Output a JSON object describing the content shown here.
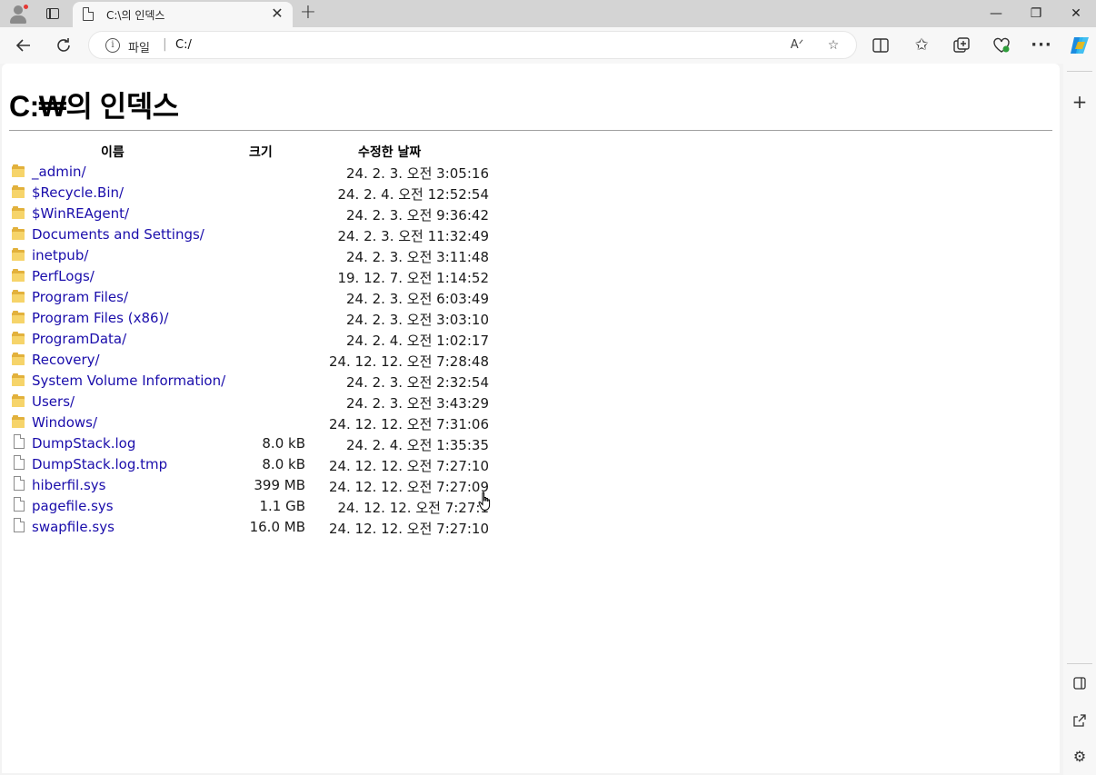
{
  "tab": {
    "title": "C:\\의 인덱스"
  },
  "window_controls": {
    "minimize": "—",
    "restore": "❐",
    "close": "✕"
  },
  "address_bar": {
    "scheme": "파일",
    "url": "C:/"
  },
  "page": {
    "title": "C:₩의 인덱스",
    "columns": {
      "name": "이름",
      "size": "크기",
      "date": "수정한 날짜"
    },
    "entries": [
      {
        "type": "folder",
        "name": "_admin/",
        "size": "",
        "date": "24. 2. 3. 오전 3:05:16"
      },
      {
        "type": "folder",
        "name": "$Recycle.Bin/",
        "size": "",
        "date": "24. 2. 4. 오전 12:52:54"
      },
      {
        "type": "folder",
        "name": "$WinREAgent/",
        "size": "",
        "date": "24. 2. 3. 오전 9:36:42"
      },
      {
        "type": "folder",
        "name": "Documents and Settings/",
        "size": "",
        "date": "24. 2. 3. 오전 11:32:49"
      },
      {
        "type": "folder",
        "name": "inetpub/",
        "size": "",
        "date": "24. 2. 3. 오전 3:11:48"
      },
      {
        "type": "folder",
        "name": "PerfLogs/",
        "size": "",
        "date": "19. 12. 7. 오전 1:14:52"
      },
      {
        "type": "folder",
        "name": "Program Files/",
        "size": "",
        "date": "24. 2. 3. 오전 6:03:49"
      },
      {
        "type": "folder",
        "name": "Program Files (x86)/",
        "size": "",
        "date": "24. 2. 3. 오전 3:03:10"
      },
      {
        "type": "folder",
        "name": "ProgramData/",
        "size": "",
        "date": "24. 2. 4. 오전 1:02:17"
      },
      {
        "type": "folder",
        "name": "Recovery/",
        "size": "",
        "date": "24. 12. 12. 오전 7:28:48"
      },
      {
        "type": "folder",
        "name": "System Volume Information/",
        "size": "",
        "date": "24. 2. 3. 오전 2:32:54"
      },
      {
        "type": "folder",
        "name": "Users/",
        "size": "",
        "date": "24. 2. 3. 오전 3:43:29"
      },
      {
        "type": "folder",
        "name": "Windows/",
        "size": "",
        "date": "24. 12. 12. 오전 7:31:06"
      },
      {
        "type": "file",
        "name": "DumpStack.log",
        "size": "8.0 kB",
        "date": "24. 2. 4. 오전 1:35:35"
      },
      {
        "type": "file",
        "name": "DumpStack.log.tmp",
        "size": "8.0 kB",
        "date": "24. 12. 12. 오전 7:27:10"
      },
      {
        "type": "file",
        "name": "hiberfil.sys",
        "size": "399 MB",
        "date": "24. 12. 12. 오전 7:27:09"
      },
      {
        "type": "file",
        "name": "pagefile.sys",
        "size": "1.1 GB",
        "date": "24. 12. 12. 오전 7:27:1"
      },
      {
        "type": "file",
        "name": "swapfile.sys",
        "size": "16.0 MB",
        "date": "24. 12. 12. 오전 7:27:10"
      }
    ]
  },
  "colors": {
    "link": "#1a0dab",
    "folder": "#f6d46a",
    "tabstrip": "#d4d4d4"
  },
  "icons": {
    "back": "back-arrow-icon",
    "refresh": "refresh-icon",
    "info": "info-icon",
    "read_aloud": "read-aloud-icon",
    "favorite": "star-icon",
    "split": "split-screen-icon",
    "favorites": "favorites-icon",
    "collections": "collections-icon",
    "performance": "heart-pulse-icon",
    "more": "more-icon",
    "copilot": "copilot-icon"
  }
}
